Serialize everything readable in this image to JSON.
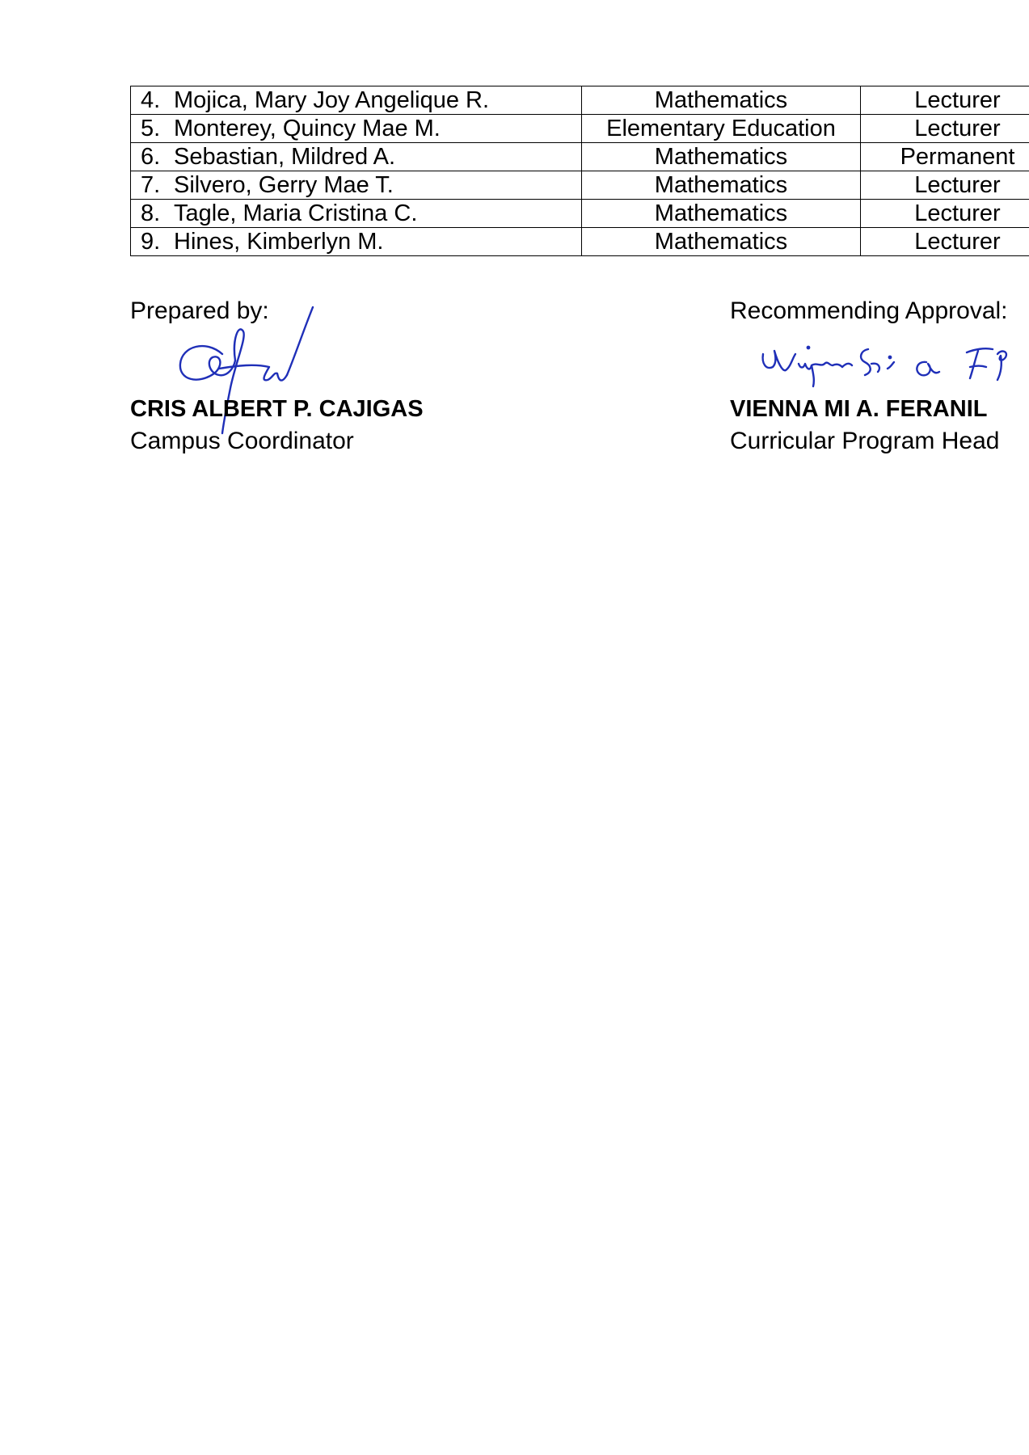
{
  "faculty_table": {
    "rows": [
      {
        "number": "4.",
        "name": "Mojica, Mary Joy Angelique R.",
        "department": "Mathematics",
        "status": "Lecturer"
      },
      {
        "number": "5.",
        "name": "Monterey, Quincy Mae M.",
        "department": "Elementary Education",
        "status": "Lecturer"
      },
      {
        "number": "6.",
        "name": "Sebastian, Mildred A.",
        "department": "Mathematics",
        "status": "Permanent"
      },
      {
        "number": "7.",
        "name": "Silvero, Gerry Mae T.",
        "department": "Mathematics",
        "status": "Lecturer"
      },
      {
        "number": "8.",
        "name": "Tagle, Maria Cristina C.",
        "department": "Mathematics",
        "status": "Lecturer"
      },
      {
        "number": "9.",
        "name": "Hines, Kimberlyn M.",
        "department": "Mathematics",
        "status": "Lecturer"
      }
    ]
  },
  "signatories": {
    "prepared": {
      "label": "Prepared by:",
      "name": "CRIS ALBERT P. CAJIGAS",
      "title": "Campus Coordinator",
      "signature_icon": "handwritten-signature"
    },
    "recommending": {
      "label": "Recommending Approval:",
      "name": "VIENNA MI A. FERANIL",
      "title": "Curricular Program Head",
      "signature_icon": "handwritten-signature"
    }
  },
  "colors": {
    "ink": "#000000",
    "signature_ink": "#1f2fb8",
    "background": "#ffffff"
  }
}
